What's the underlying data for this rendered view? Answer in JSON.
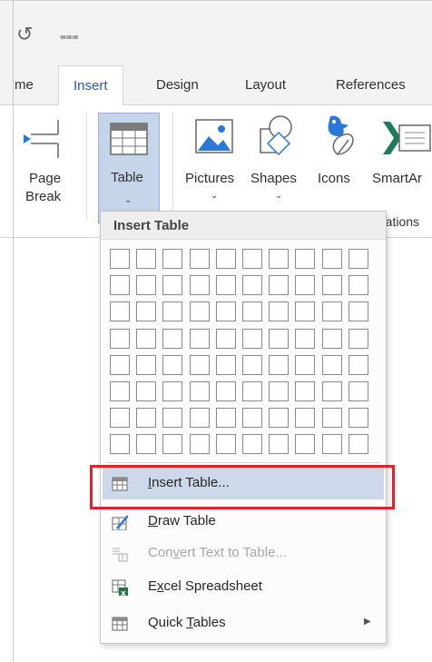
{
  "quick_access": {
    "undo_icon": "redo-icon",
    "more_icon": "customize-qat-icon"
  },
  "tabs": [
    {
      "label": "me",
      "active": false
    },
    {
      "label": "Insert",
      "active": true
    },
    {
      "label": "Design",
      "active": false
    },
    {
      "label": "Layout",
      "active": false
    },
    {
      "label": "References",
      "active": false
    }
  ],
  "ribbon": {
    "page_break": {
      "line1": "Page",
      "line2": "Break",
      "icon": "page-break-icon"
    },
    "table": {
      "label": "Table",
      "icon": "table-icon"
    },
    "pictures": {
      "label": "Pictures",
      "icon": "pictures-icon"
    },
    "shapes": {
      "label": "Shapes",
      "icon": "shapes-icon"
    },
    "icons": {
      "label": "Icons",
      "icon": "icons-icon"
    },
    "smartart": {
      "label": "SmartAr",
      "icon": "smartart-icon"
    },
    "group_label": "rations"
  },
  "menu": {
    "header": "Insert Table",
    "grid": {
      "rows": 8,
      "cols": 10
    },
    "items": [
      {
        "pre": "",
        "ul": "I",
        "post": "nsert Table...",
        "icon": "insert-table-icon",
        "highlighted": true,
        "disabled": false
      },
      {
        "pre": "",
        "ul": "D",
        "post": "raw Table",
        "icon": "draw-table-icon",
        "highlighted": false,
        "disabled": false
      },
      {
        "pre": "Con",
        "ul": "v",
        "post": "ert Text to Table...",
        "icon": "convert-text-to-table-icon",
        "highlighted": false,
        "disabled": true
      },
      {
        "pre": "E",
        "ul": "x",
        "post": "cel Spreadsheet",
        "icon": "excel-spreadsheet-icon",
        "highlighted": false,
        "disabled": false
      },
      {
        "pre": "Quick ",
        "ul": "T",
        "post": "ables",
        "icon": "quick-tables-icon",
        "highlighted": false,
        "disabled": false
      }
    ]
  },
  "colors": {
    "active_tab_text": "#2b579a",
    "table_button_bg": "#c5d5ea",
    "menu_highlight": "#cdd9ea",
    "annotation_red": "#e2222a",
    "excel_green": "#217346"
  }
}
